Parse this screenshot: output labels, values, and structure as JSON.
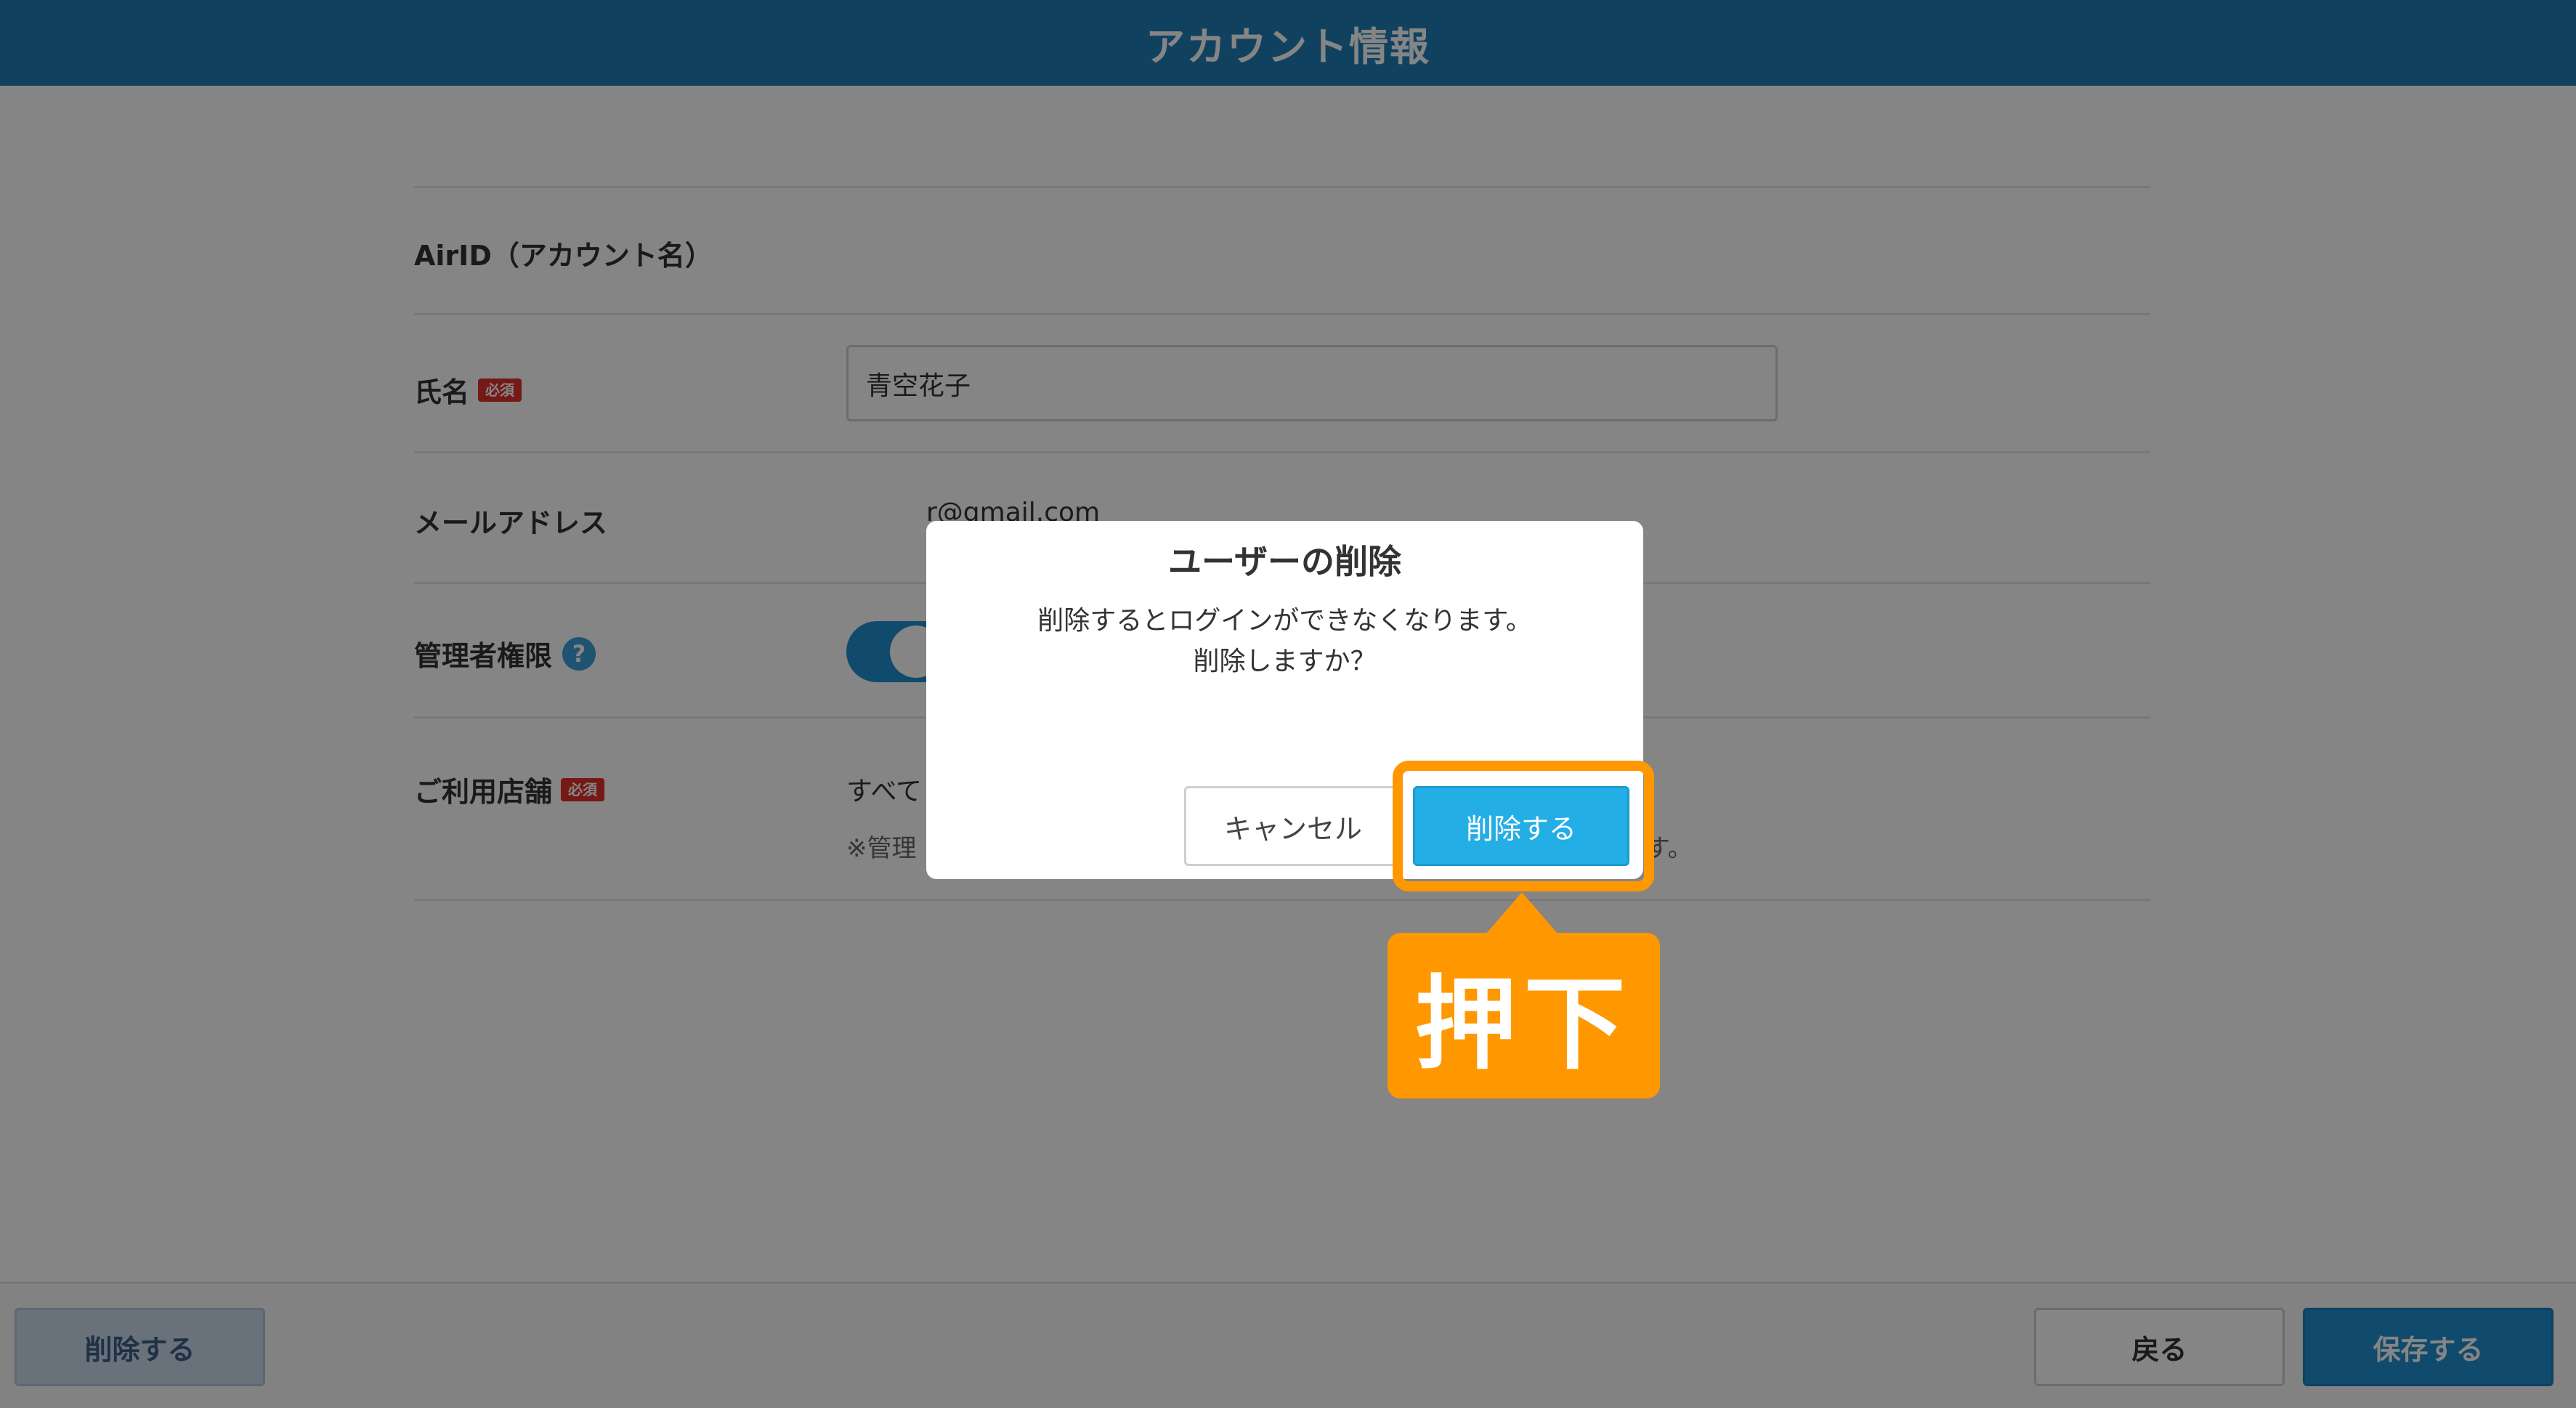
{
  "header": {
    "title": "アカウント情報"
  },
  "form": {
    "airid": {
      "label": "AirID（アカウント名）"
    },
    "name": {
      "label": "氏名",
      "badge": "必須",
      "value": "青空花子"
    },
    "email": {
      "label": "メールアドレス",
      "value": "r@gmail.com"
    },
    "admin": {
      "label": "管理者権限",
      "help_icon": "?"
    },
    "store": {
      "label": "ご利用店舗",
      "badge": "必須",
      "value": "すべて",
      "note": "※管理",
      "note_tail": "す。"
    }
  },
  "footer": {
    "delete_label": "削除する",
    "back_label": "戻る",
    "save_label": "保存する"
  },
  "modal": {
    "title": "ユーザーの削除",
    "message_line1": "削除するとログインができなくなります。",
    "message_line2": "削除しますか？",
    "cancel_label": "キャンセル",
    "delete_label": "削除する"
  },
  "annotation": {
    "label": "押下"
  },
  "colors": {
    "header": "#1f7fb8",
    "primary": "#24aee6",
    "required": "#e0312b",
    "highlight": "#ff9800"
  }
}
